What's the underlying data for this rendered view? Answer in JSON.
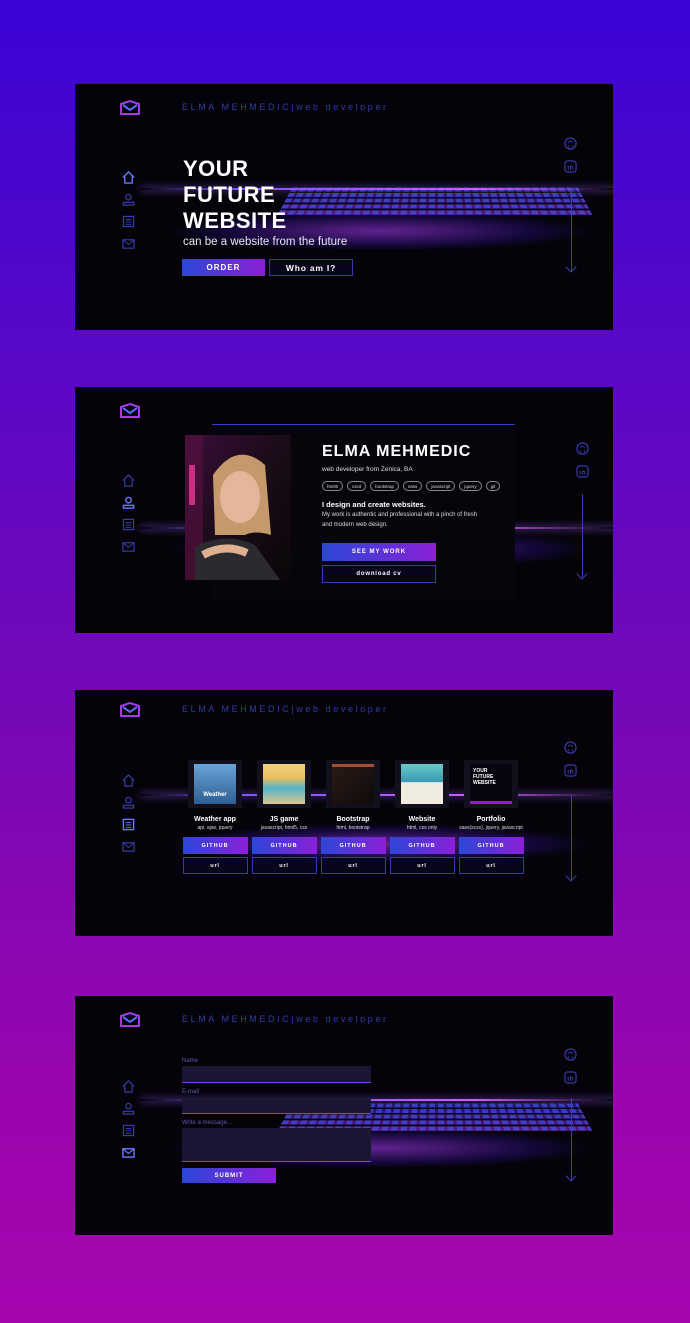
{
  "brand": {
    "name": "ELMA MEHMEDIC",
    "suffix": "|web developer"
  },
  "hero": {
    "line1": "YOUR",
    "line2": "FUTURE",
    "line3": "WEBSITE",
    "subtitle": "can be a website from the future",
    "order_label": "ORDER",
    "whoami_label": "Who am I?"
  },
  "about": {
    "name": "ELMA MEHMEDIC",
    "role": "web developer from Zenica, BA",
    "tags": [
      "html5",
      "css3",
      "bootstrap",
      "sass",
      "javascript",
      "jquery",
      "git"
    ],
    "headline": "I design and create websites.",
    "text": "My work is authentic and professional with a pinch of fresh and modern web design.",
    "see_work_label": "SEE MY WORK",
    "download_label": "download cv"
  },
  "projects": [
    {
      "name": "Weather app",
      "tech": "api, ajax, jquery",
      "thumb_text": "Weather",
      "github": "GITHUB",
      "url": "url"
    },
    {
      "name": "JS game",
      "tech": "javascript, html5, css",
      "thumb_text": "",
      "github": "GITHUB",
      "url": "url"
    },
    {
      "name": "Bootstrap",
      "tech": "html, bootstrap",
      "thumb_text": "",
      "github": "GITHUB",
      "url": "url"
    },
    {
      "name": "Website",
      "tech": "html, css only",
      "thumb_text": "",
      "github": "GITHUB",
      "url": "url"
    },
    {
      "name": "Portfolio",
      "tech": "sass(scss), jquery, javascript",
      "thumb_text": "YOUR FUTURE WEBSITE",
      "github": "GITHUB",
      "url": "url"
    }
  ],
  "contact": {
    "name_label": "Name",
    "email_label": "E-mail",
    "message_label": "Write a message...",
    "submit_label": "SUBMIT"
  },
  "icons": {
    "logo": "envelope-logo-icon",
    "nav": [
      "home-icon",
      "user-icon",
      "document-icon",
      "mail-icon"
    ],
    "social": [
      "github-icon",
      "linkedin-icon"
    ],
    "scroll": "arrow-down-icon"
  },
  "colors": {
    "accent_blue": "#2b47d6",
    "accent_purple": "#8b1fd8",
    "nav_icon": "#3a3fb4",
    "active_icon": "#6a78ff"
  }
}
